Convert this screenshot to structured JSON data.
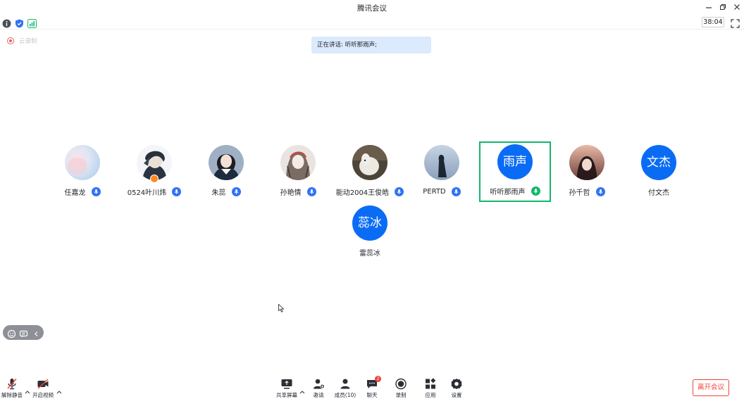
{
  "window": {
    "title": "腾讯会议"
  },
  "status": {
    "timer": "38:04",
    "icons": [
      "info-icon",
      "shield-icon",
      "signal-icon",
      "fullscreen-icon"
    ]
  },
  "recording": {
    "label": "云录制"
  },
  "speaking": {
    "text": "正在讲话: 听听那雨声;"
  },
  "participants": [
    {
      "name": "任嘉龙",
      "avatar": "photo",
      "mic": "on"
    },
    {
      "name": "0524叶川炜",
      "avatar": "photo",
      "mic": "on",
      "host": true
    },
    {
      "name": "朱蕊",
      "avatar": "photo",
      "mic": "on"
    },
    {
      "name": "孙艳情",
      "avatar": "photo",
      "mic": "on"
    },
    {
      "name": "能动2004王俊皓",
      "avatar": "photo",
      "mic": "on"
    },
    {
      "name": "PERTD",
      "avatar": "photo",
      "mic": "on"
    },
    {
      "name": "听听那雨声",
      "avatar_text": "雨声",
      "avatar": "initial",
      "mic": "speaking",
      "active": true
    },
    {
      "name": "孙千哲",
      "avatar": "photo",
      "mic": "on"
    },
    {
      "name": "付文杰",
      "avatar_text": "文杰",
      "avatar": "initial",
      "mic": "none"
    },
    {
      "name": "雷蕊冰",
      "avatar_text": "蕊冰",
      "avatar": "initial",
      "mic": "none"
    }
  ],
  "toolbar": {
    "unmute": "解除静音",
    "start_video": "开启视频",
    "share_screen": "共享屏幕",
    "invite": "邀请",
    "members": "成员(10)",
    "chat": "聊天",
    "chat_badge": "2",
    "record": "录制",
    "apps": "应用",
    "settings": "设置",
    "leave": "离开会议"
  },
  "colors": {
    "accent": "#0a6cf5",
    "speaking": "#12b76a",
    "danger": "#f04438",
    "banner": "#dbeafc"
  }
}
